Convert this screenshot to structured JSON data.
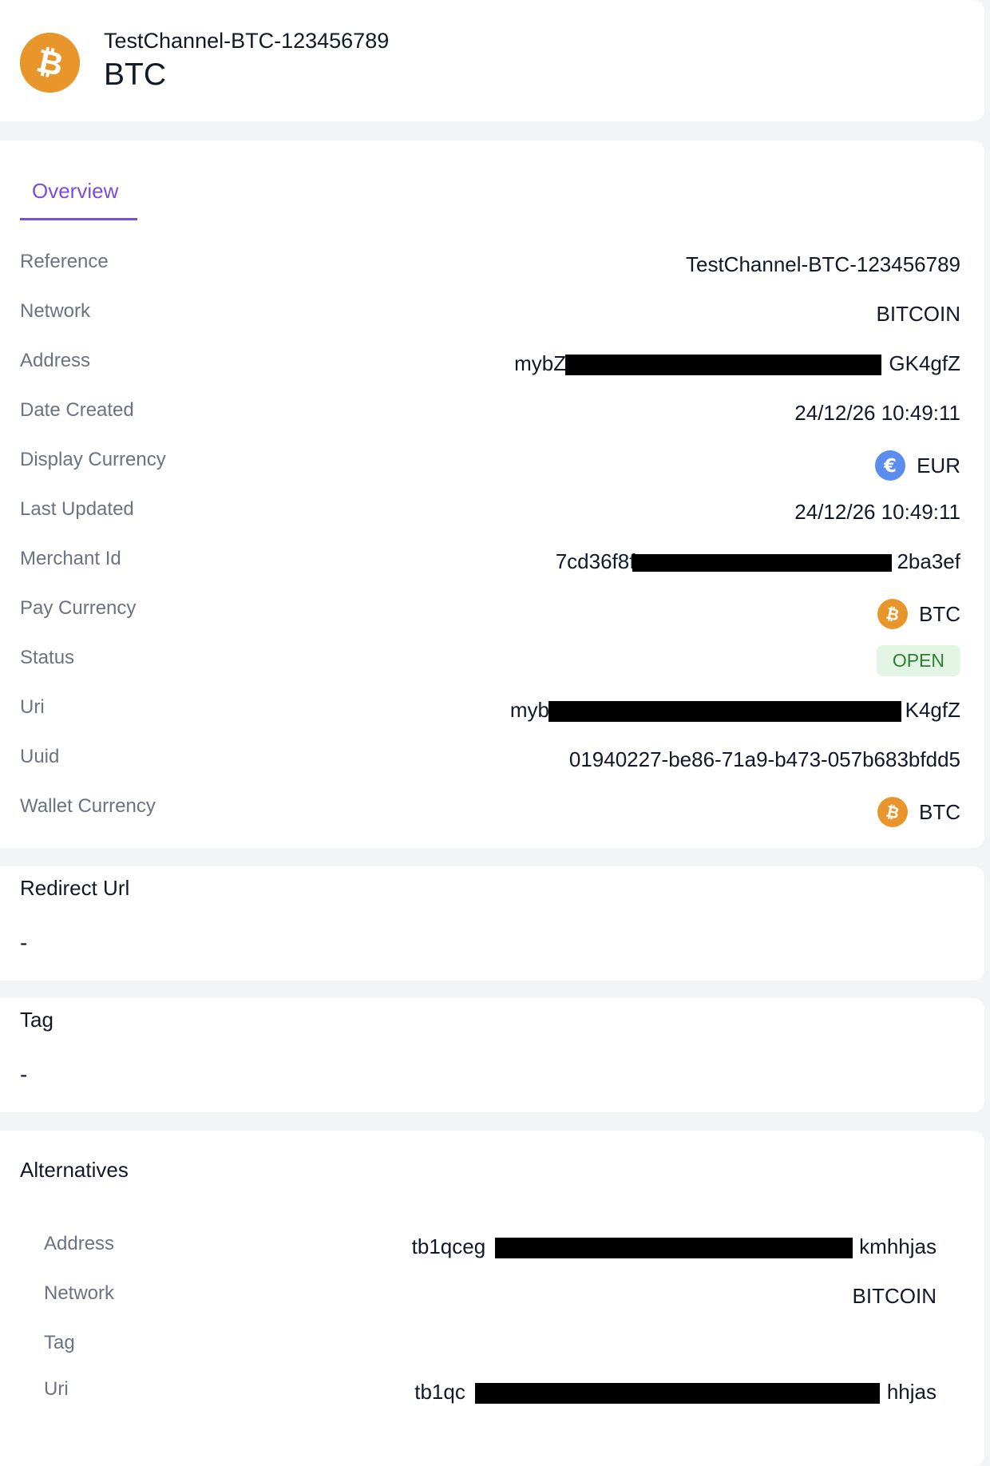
{
  "header": {
    "subtitle": "TestChannel-BTC-123456789",
    "title": "BTC",
    "coin_color": "#e8962b"
  },
  "tabs": [
    {
      "label": "Overview",
      "active": true
    }
  ],
  "overview": {
    "reference": {
      "label": "Reference",
      "value": "TestChannel-BTC-123456789"
    },
    "network": {
      "label": "Network",
      "value": "BITCOIN"
    },
    "address": {
      "label": "Address",
      "value_start": "mybZeBe",
      "value_end": "GK4gfZ"
    },
    "date_created": {
      "label": "Date Created",
      "value": "24/12/26 10:49:11"
    },
    "display_currency": {
      "label": "Display Currency",
      "value": "EUR",
      "icon": "euro-icon"
    },
    "last_updated": {
      "label": "Last Updated",
      "value": "24/12/26 10:49:11"
    },
    "merchant_id": {
      "label": "Merchant Id",
      "value_start": "7cd36f8f",
      "value_end": "2ba3ef"
    },
    "pay_currency": {
      "label": "Pay Currency",
      "value": "BTC",
      "icon": "bitcoin-icon"
    },
    "status": {
      "label": "Status",
      "value": "OPEN"
    },
    "uri": {
      "label": "Uri",
      "value_start": "mybZeE",
      "value_end": "K4gfZ"
    },
    "uuid": {
      "label": "Uuid",
      "value": "01940227-be86-71a9-b473-057b683bfdd5"
    },
    "wallet_currency": {
      "label": "Wallet Currency",
      "value": "BTC",
      "icon": "bitcoin-icon"
    }
  },
  "redirect_url": {
    "title": "Redirect Url",
    "value": "-"
  },
  "tag": {
    "title": "Tag",
    "value": "-"
  },
  "alternatives": {
    "title": "Alternatives",
    "address": {
      "label": "Address",
      "value_start": "tb1qceg",
      "value_end": "kmhhjas"
    },
    "network": {
      "label": "Network",
      "value": "BITCOIN"
    },
    "tag": {
      "label": "Tag",
      "value": ""
    },
    "uri": {
      "label": "Uri",
      "value_start": "tb1qc",
      "value_end": "hhjas"
    }
  },
  "colors": {
    "accent": "#7c4ddb",
    "bitcoin": "#e8962b",
    "euro": "#5b8def",
    "status_bg": "#e3f5e4",
    "status_text": "#2f7d32"
  }
}
